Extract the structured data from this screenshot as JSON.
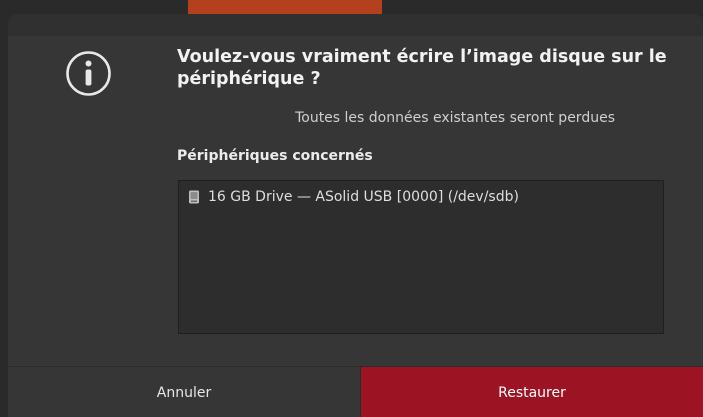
{
  "dialog": {
    "title": "Voulez-vous vraiment écrire l’image disque sur le périphérique ?",
    "subtitle": "Toutes les données existantes seront perdues",
    "section_label": "Périphériques concernés",
    "icon": "info-icon"
  },
  "devices": [
    {
      "label": "16 GB Drive — ASolid USB [0000] (/dev/sdb)",
      "icon": "drive-icon"
    }
  ],
  "buttons": {
    "cancel_label": "Annuler",
    "restore_label": "Restaurer"
  },
  "colors": {
    "dialog_bg": "#363636",
    "destructive_button": "#9c1324",
    "text_primary": "#f2f2f2"
  }
}
